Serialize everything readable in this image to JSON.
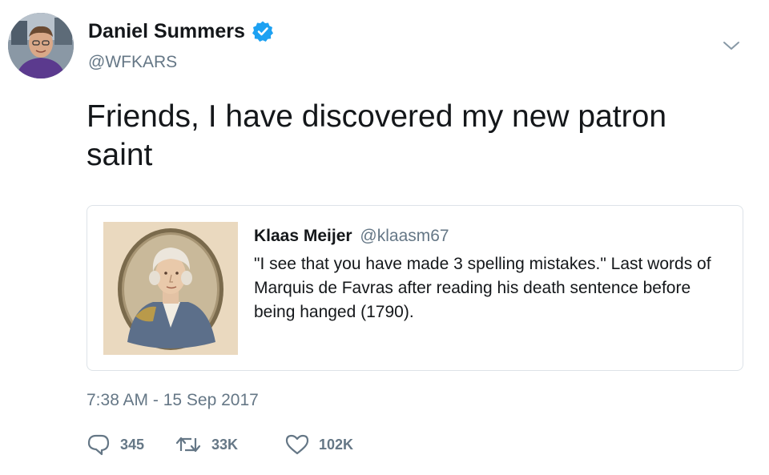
{
  "author": {
    "display_name": "Daniel Summers",
    "handle": "@WFKARS",
    "verified": true,
    "avatar": "profile-photo"
  },
  "tweet": {
    "text": "Friends, I have discovered my new patron saint",
    "timestamp": "7:38 AM - 15 Sep 2017"
  },
  "quoted_tweet": {
    "display_name": "Klaas Meijer",
    "handle": "@klaasm67",
    "text": "\"I see that you have made 3 spelling mistakes.\" Last words of Marquis de Favras after reading his death sentence before being hanged (1790).",
    "image": "portrait-engraving"
  },
  "actions": {
    "reply": {
      "icon": "reply-icon",
      "count": "345"
    },
    "retweet": {
      "icon": "retweet-icon",
      "count": "33K"
    },
    "like": {
      "icon": "heart-icon",
      "count": "102K"
    }
  },
  "colors": {
    "text": "#14171a",
    "secondary": "#657786",
    "verified": "#1da1f2",
    "border": "#dde3e8"
  },
  "menu": {
    "icon": "chevron-down-icon"
  }
}
